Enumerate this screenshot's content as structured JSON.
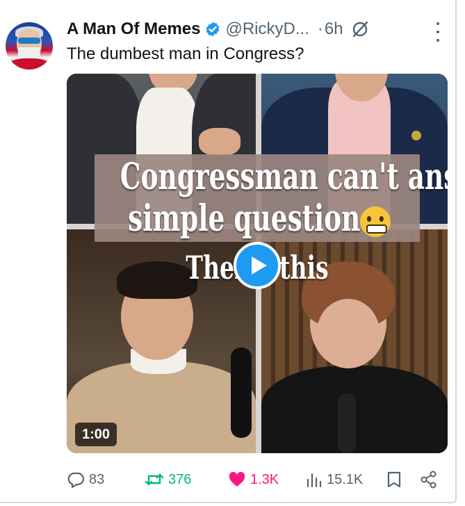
{
  "tweet": {
    "display_name": "A Man Of Memes",
    "handle": "@RickyD...",
    "separator": "·",
    "time": "6h",
    "text": "The dumbest man in Congress?"
  },
  "media": {
    "caption_line1": "Congressman can't answer",
    "caption_line2": "simple question",
    "caption_line3_left": "Ther",
    "caption_line3_right": "this",
    "duration": "1:00"
  },
  "actions": {
    "replies": "83",
    "reposts": "376",
    "likes": "1.3K",
    "views": "15.1K"
  },
  "colors": {
    "accent": "#1d9bf0",
    "secondary_text": "#536471",
    "repost_active": "#00ba7c",
    "like_active": "#f91880"
  },
  "icons": {
    "verified": "verified-badge-icon",
    "grok": "grok-icon",
    "more": "more-vertical-icon",
    "reply": "reply-icon",
    "repost": "repost-icon",
    "like": "heart-icon",
    "views": "views-icon",
    "bookmark": "bookmark-icon",
    "share": "share-icon",
    "play": "play-icon"
  }
}
